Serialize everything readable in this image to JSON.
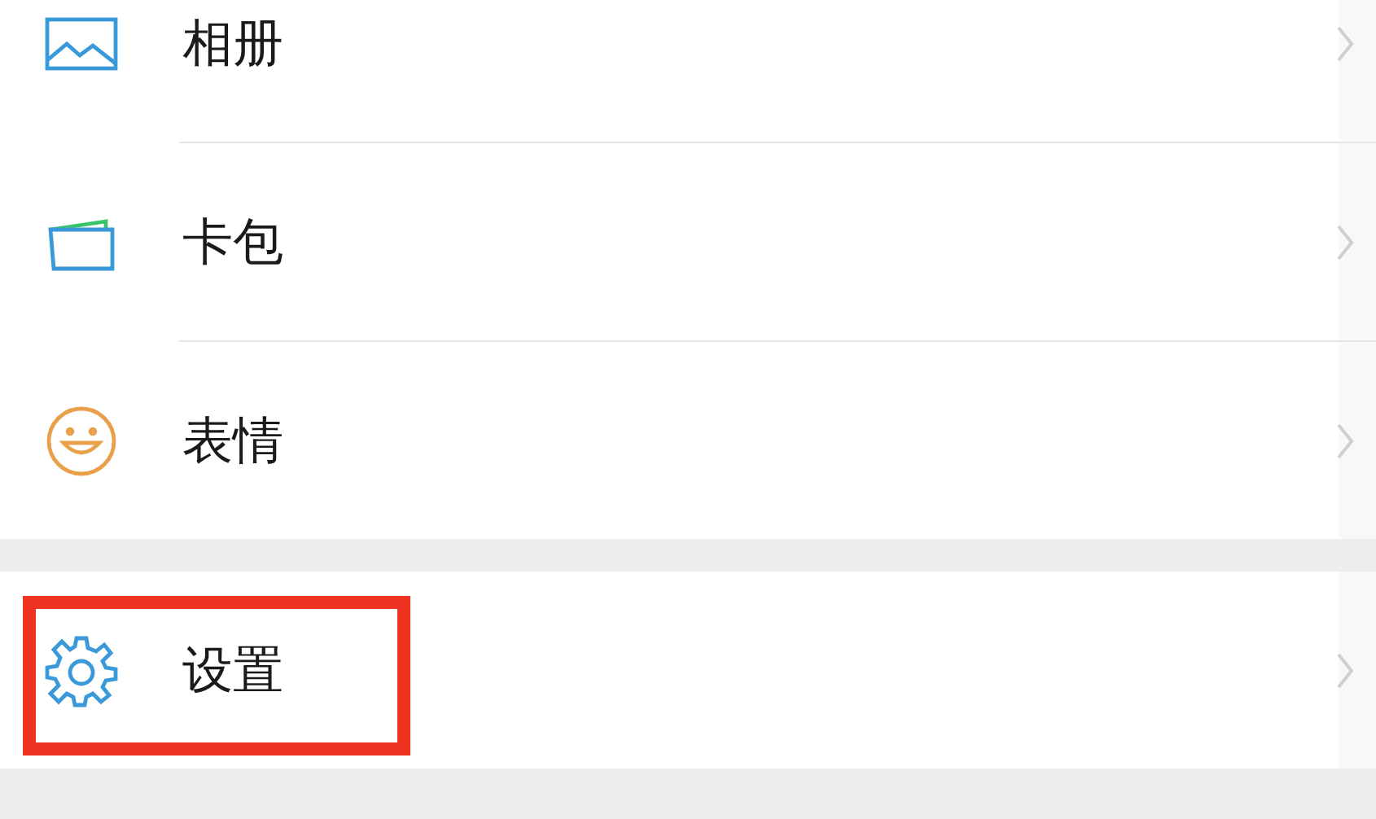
{
  "groups": [
    {
      "items": [
        {
          "kind": "album",
          "label": "相册",
          "highlighted": false
        },
        {
          "kind": "cards",
          "label": "卡包",
          "highlighted": false
        },
        {
          "kind": "stickers",
          "label": "表情",
          "highlighted": false
        }
      ]
    },
    {
      "items": [
        {
          "kind": "settings",
          "label": "设置",
          "highlighted": true
        }
      ]
    }
  ]
}
